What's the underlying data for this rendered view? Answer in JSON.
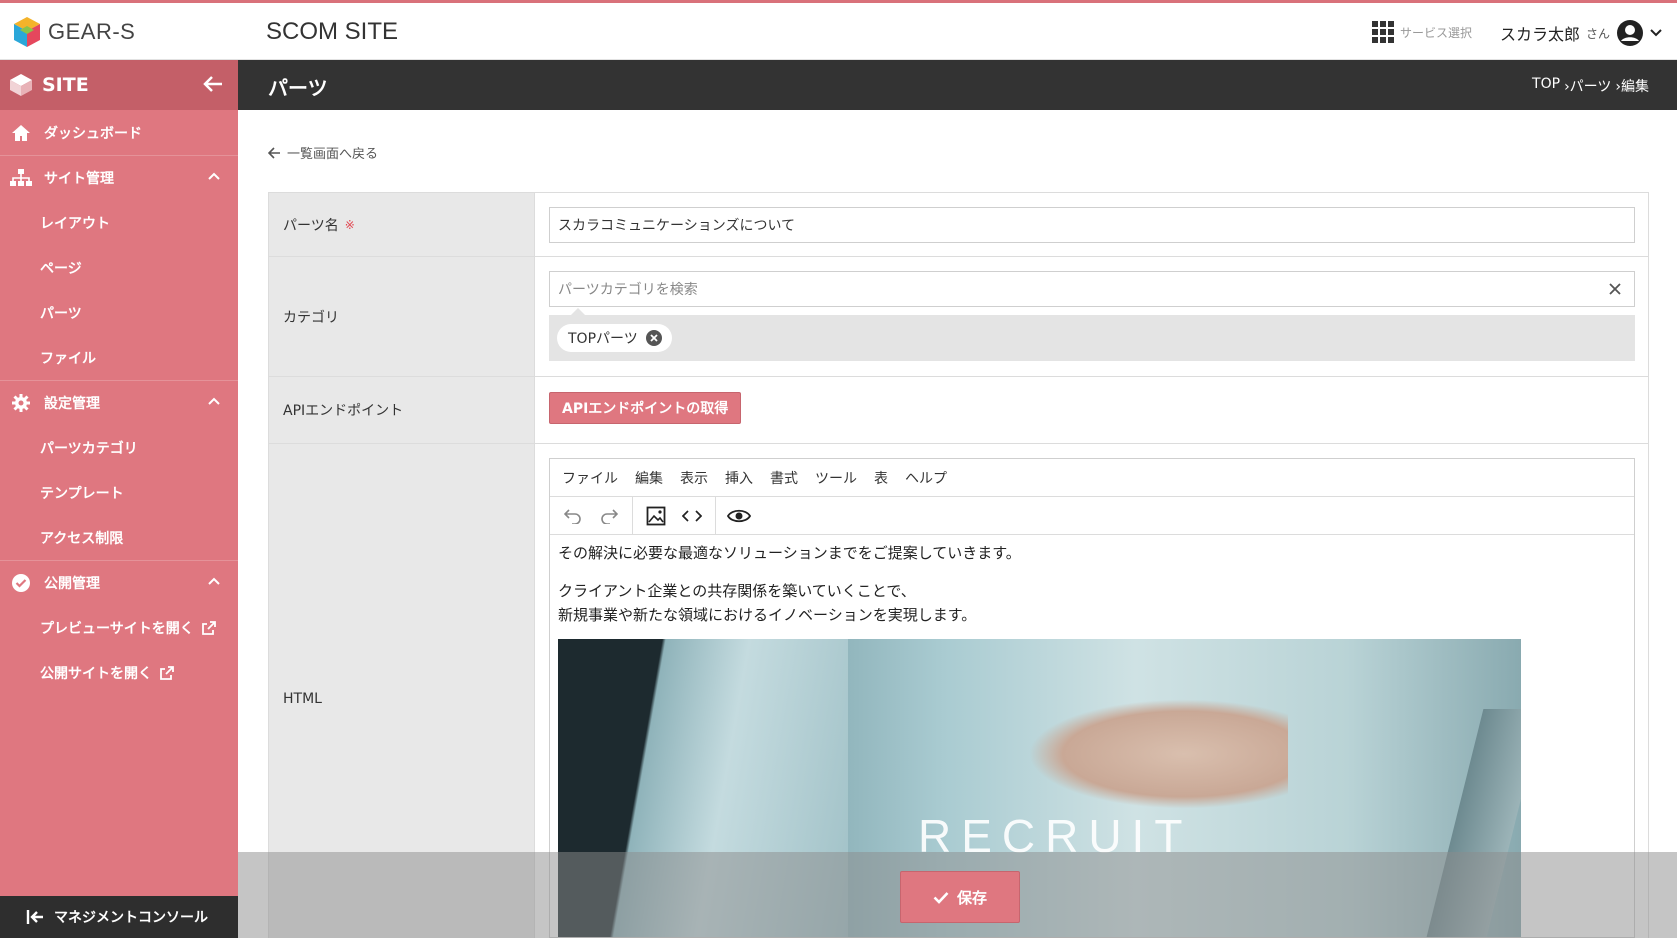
{
  "header": {
    "brand": "GEAR-S",
    "site_name": "SCOM SITE",
    "service_select": "サービス選択",
    "user_name": "スカラ太郎",
    "user_suffix": "さん"
  },
  "sidebar": {
    "title": "SITE",
    "dashboard": "ダッシュボード",
    "site_mgmt": {
      "label": "サイト管理",
      "items": [
        "レイアウト",
        "ページ",
        "パーツ",
        "ファイル"
      ]
    },
    "settings": {
      "label": "設定管理",
      "items": [
        "パーツカテゴリ",
        "テンプレート",
        "アクセス制限"
      ]
    },
    "publish": {
      "label": "公開管理",
      "items": [
        "プレビューサイトを開く",
        "公開サイトを開く"
      ]
    },
    "footer": "マネジメントコンソール"
  },
  "page": {
    "title": "パーツ",
    "breadcrumb": [
      "TOP",
      "›パーツ",
      "›編集"
    ],
    "back_link": "一覧画面へ戻る"
  },
  "form": {
    "name_label": "パーツ名",
    "required_mark": "※",
    "name_value": "スカラコミュニケーションズについて",
    "category_label": "カテゴリ",
    "category_placeholder": "パーツカテゴリを検索",
    "category_tag": "TOPパーツ",
    "api_label": "APIエンドポイント",
    "api_button": "APIエンドポイントの取得",
    "html_label": "HTML"
  },
  "editor": {
    "menu": [
      "ファイル",
      "編集",
      "表示",
      "挿入",
      "書式",
      "ツール",
      "表",
      "ヘルプ"
    ],
    "line1": "その解決に必要な最適なソリューションまでをご提案していきます。",
    "line2": "クライアント企業との共存関係を築いていくことで、",
    "line3": "新規事業や新たな領域におけるイノベーションを実現します。",
    "image_text": "RECRUIT"
  },
  "actions": {
    "save": "保存"
  },
  "colors": {
    "accent": "#df7780",
    "accent_dark": "#c45f68",
    "header_dark": "#333333"
  }
}
